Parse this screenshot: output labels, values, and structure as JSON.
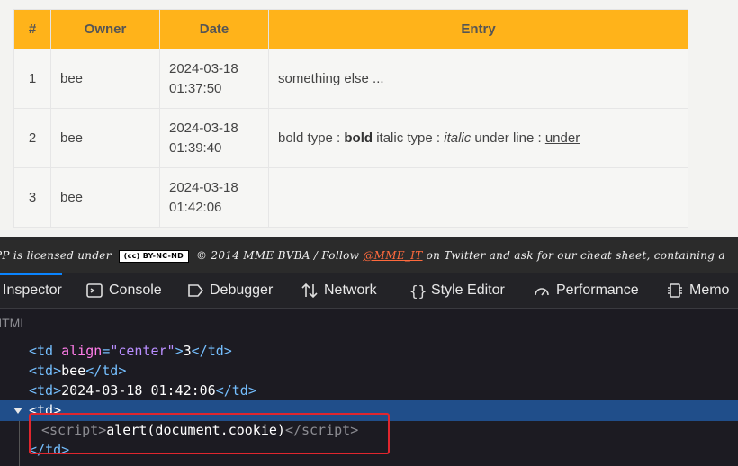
{
  "table": {
    "headers": [
      "#",
      "Owner",
      "Date",
      "Entry"
    ],
    "rows": [
      {
        "num": "1",
        "owner": "bee",
        "date_line1": "2024-03-18",
        "date_line2": "01:37:50",
        "entry": "something else ..."
      },
      {
        "num": "2",
        "owner": "bee",
        "date_line1": "2024-03-18",
        "date_line2": "01:39:40",
        "entry_parts": {
          "p1": "bold type : ",
          "bold": "bold",
          "p2": " italic type : ",
          "italic": "italic",
          "p3": " under line : ",
          "under": "under"
        }
      },
      {
        "num": "3",
        "owner": "bee",
        "date_line1": "2024-03-18",
        "date_line2": "01:42:06",
        "entry": ""
      }
    ]
  },
  "footer": {
    "prefix": "PP is licensed under",
    "badge": "(cc) BY-NC-ND",
    "middle": "© 2014 MME BVBA / Follow",
    "link": "@MME_IT",
    "suffix": "on Twitter and ask for our cheat sheet, containing a"
  },
  "devtools": {
    "tabs": [
      {
        "label": "Inspector",
        "icon": "inspector-icon",
        "active": true
      },
      {
        "label": "Console",
        "icon": "console-icon"
      },
      {
        "label": "Debugger",
        "icon": "debugger-icon"
      },
      {
        "label": "Network",
        "icon": "network-icon"
      },
      {
        "label": "Style Editor",
        "icon": "style-editor-icon"
      },
      {
        "label": "Performance",
        "icon": "performance-icon"
      },
      {
        "label": "Memo",
        "icon": "memory-icon"
      }
    ],
    "breadcrumb": "HTML",
    "markup": {
      "l1": {
        "tag": "td",
        "attr": "align",
        "val": "\"center\"",
        "text": "3"
      },
      "l2": {
        "tag": "td",
        "text": "bee"
      },
      "l3": {
        "tag": "td",
        "text": "2024-03-18 01:42:06"
      },
      "l4": {
        "tag": "td"
      },
      "l5": {
        "tag": "script",
        "text": "alert(document.cookie)"
      },
      "l6": {
        "tag": "td"
      }
    },
    "accent": "#0a84ff",
    "selection_color": "#204e8a",
    "highlight_color": "#e0262e"
  }
}
